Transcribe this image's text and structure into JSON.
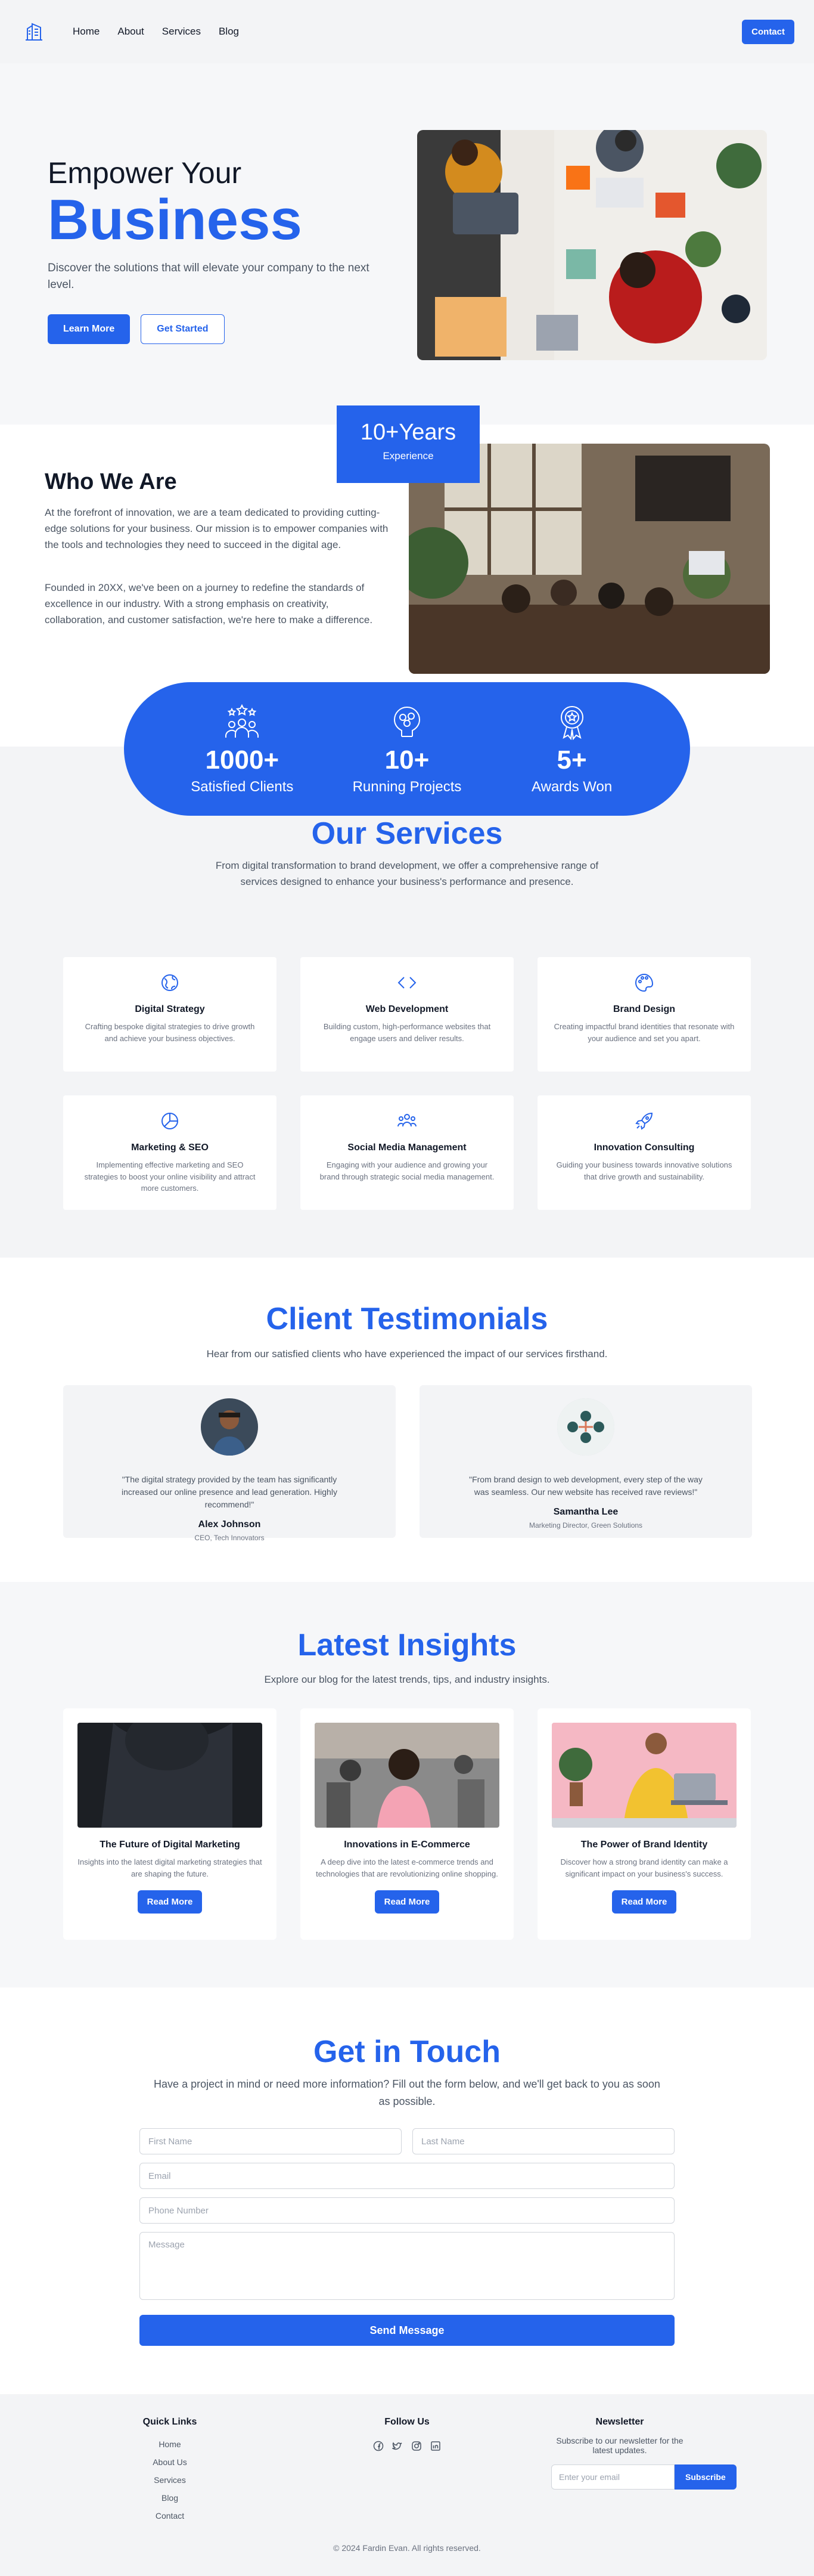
{
  "nav": {
    "links": [
      "Home",
      "About",
      "Services",
      "Blog"
    ],
    "contact_label": "Contact"
  },
  "hero": {
    "line1": "Empower Your",
    "line2": "Business",
    "subtitle": "Discover the solutions that will elevate your company to the next level.",
    "primary_btn": "Learn More",
    "secondary_btn": "Get Started"
  },
  "who": {
    "title": "Who We Are",
    "p1": "At the forefront of innovation, we are a team dedicated to providing cutting-edge solutions for your business. Our mission is to empower companies with the tools and technologies they need to succeed in the digital age.",
    "p2": "Founded in 20XX, we've been on a journey to redefine the standards of excellence in our industry. With a strong emphasis on creativity, collaboration, and customer satisfaction, we're here to make a difference.",
    "badge_num": "10+Years",
    "badge_label": "Experience"
  },
  "stats": [
    {
      "icon": "people-icon",
      "num": "1000+",
      "label": "Satisfied Clients"
    },
    {
      "icon": "brain-icon",
      "num": "10+",
      "label": "Running Projects"
    },
    {
      "icon": "award-icon",
      "num": "5+",
      "label": "Awards Won"
    }
  ],
  "services": {
    "title": "Our Services",
    "subtitle": "From digital transformation to brand development, we offer a comprehensive range of services designed to enhance your business's performance and presence.",
    "items": [
      {
        "icon": "strategy-icon",
        "title": "Digital Strategy",
        "desc": "Crafting bespoke digital strategies to drive growth and achieve your business objectives."
      },
      {
        "icon": "code-icon",
        "title": "Web Development",
        "desc": "Building custom, high-performance websites that engage users and deliver results."
      },
      {
        "icon": "palette-icon",
        "title": "Brand Design",
        "desc": "Creating impactful brand identities that resonate with your audience and set you apart."
      },
      {
        "icon": "pie-chart-icon",
        "title": "Marketing & SEO",
        "desc": "Implementing effective marketing and SEO strategies to boost your online visibility and attract more customers."
      },
      {
        "icon": "users-icon",
        "title": "Social Media Management",
        "desc": "Engaging with your audience and growing your brand through strategic social media management."
      },
      {
        "icon": "rocket-icon",
        "title": "Innovation Consulting",
        "desc": "Guiding your business towards innovative solutions that drive growth and sustainability."
      }
    ]
  },
  "testimonials": {
    "title": "Client Testimonials",
    "subtitle": "Hear from our satisfied clients who have experienced the impact of our services firsthand.",
    "items": [
      {
        "quote": "\"The digital strategy provided by the team has significantly increased our online presence and lead generation. Highly recommend!\"",
        "name": "Alex Johnson",
        "role": "CEO, Tech Innovators"
      },
      {
        "quote": "\"From brand design to web development, every step of the way was seamless. Our new website has received rave reviews!\"",
        "name": "Samantha Lee",
        "role": "Marketing Director, Green Solutions"
      }
    ]
  },
  "insights": {
    "title": "Latest Insights",
    "subtitle": "Explore our blog for the latest trends, tips, and industry insights.",
    "items": [
      {
        "title": "The Future of Digital Marketing",
        "desc": "Insights into the latest digital marketing strategies that are shaping the future.",
        "btn": "Read More"
      },
      {
        "title": "Innovations in E-Commerce",
        "desc": "A deep dive into the latest e-commerce trends and technologies that are revolutionizing online shopping.",
        "btn": "Read More"
      },
      {
        "title": "The Power of Brand Identity",
        "desc": "Discover how a strong brand identity can make a significant impact on your business's success.",
        "btn": "Read More"
      }
    ]
  },
  "contact": {
    "title": "Get in Touch",
    "subtitle": "Have a project in mind or need more information? Fill out the form below, and we'll get back to you as soon as possible.",
    "first_name": "First Name",
    "last_name": "Last Name",
    "email": "Email",
    "phone": "Phone Number",
    "message": "Message",
    "submit": "Send Message"
  },
  "footer": {
    "quick_links_title": "Quick Links",
    "quick_links": [
      "Home",
      "About Us",
      "Services",
      "Blog",
      "Contact"
    ],
    "follow_title": "Follow Us",
    "newsletter_title": "Newsletter",
    "newsletter_sub": "Subscribe to our newsletter for the latest updates.",
    "newsletter_placeholder": "Enter your email",
    "subscribe": "Subscribe",
    "copyright": "© 2024 Fardin Evan. All rights reserved."
  },
  "colors": {
    "accent": "#2563eb"
  }
}
